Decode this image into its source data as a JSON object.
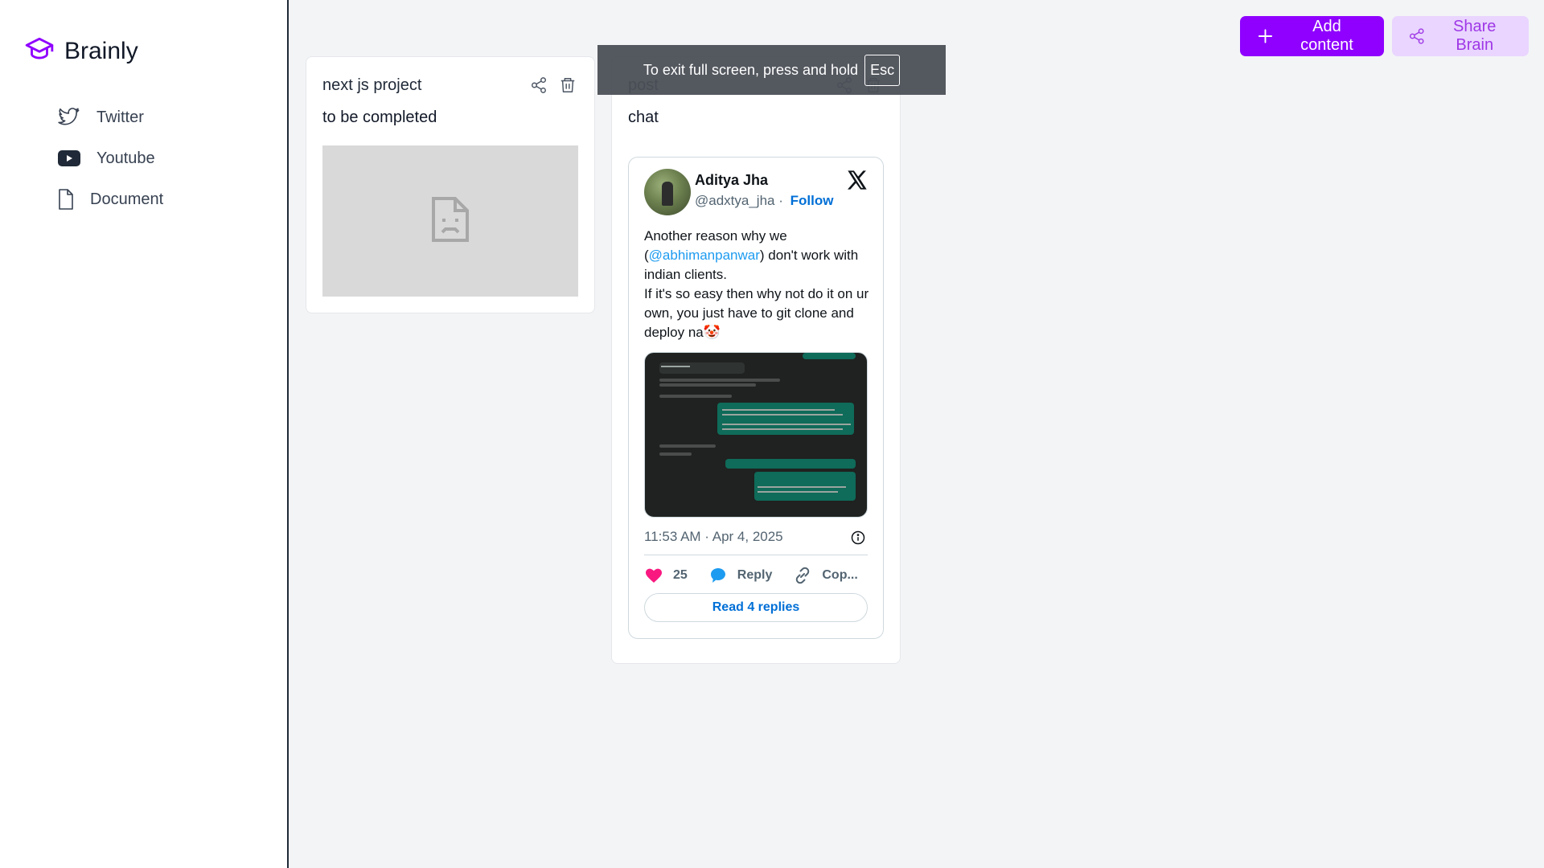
{
  "app": {
    "brand_name": "Brainly",
    "accent_color": "#8f00ff",
    "brand_icon": "graduation-cap-icon"
  },
  "sidebar": {
    "items": [
      {
        "label": "Twitter",
        "icon": "twitter-icon"
      },
      {
        "label": "Youtube",
        "icon": "youtube-icon"
      },
      {
        "label": "Document",
        "icon": "document-icon"
      }
    ]
  },
  "header": {
    "add_content_label": "Add content",
    "share_brain_label": "Share Brain"
  },
  "cards": [
    {
      "title": "next js project",
      "description": "to be completed",
      "embed": "broken-embed-icon"
    },
    {
      "title": "post",
      "description": "chat",
      "tweet": {
        "author_name": "Aditya Jha",
        "handle": "@adxtya_jha",
        "separator": "·",
        "follow_label": "Follow",
        "text_line1": "Another reason why we",
        "text_open": "(",
        "mention": "@abhimanpanwar",
        "text_after_mention": ") don't work with indian clients.",
        "text_line3": "If it's so easy then why not do it on ur own, you just have to git clone and deploy na🤡",
        "timestamp": "11:53 AM · Apr 4, 2025",
        "likes": "25",
        "reply_label": "Reply",
        "copy_label": "Cop...",
        "read_replies_label": "Read 4 replies"
      }
    }
  ],
  "fullscreen_toast": {
    "message": "To exit full screen, press and hold",
    "key": "Esc"
  }
}
